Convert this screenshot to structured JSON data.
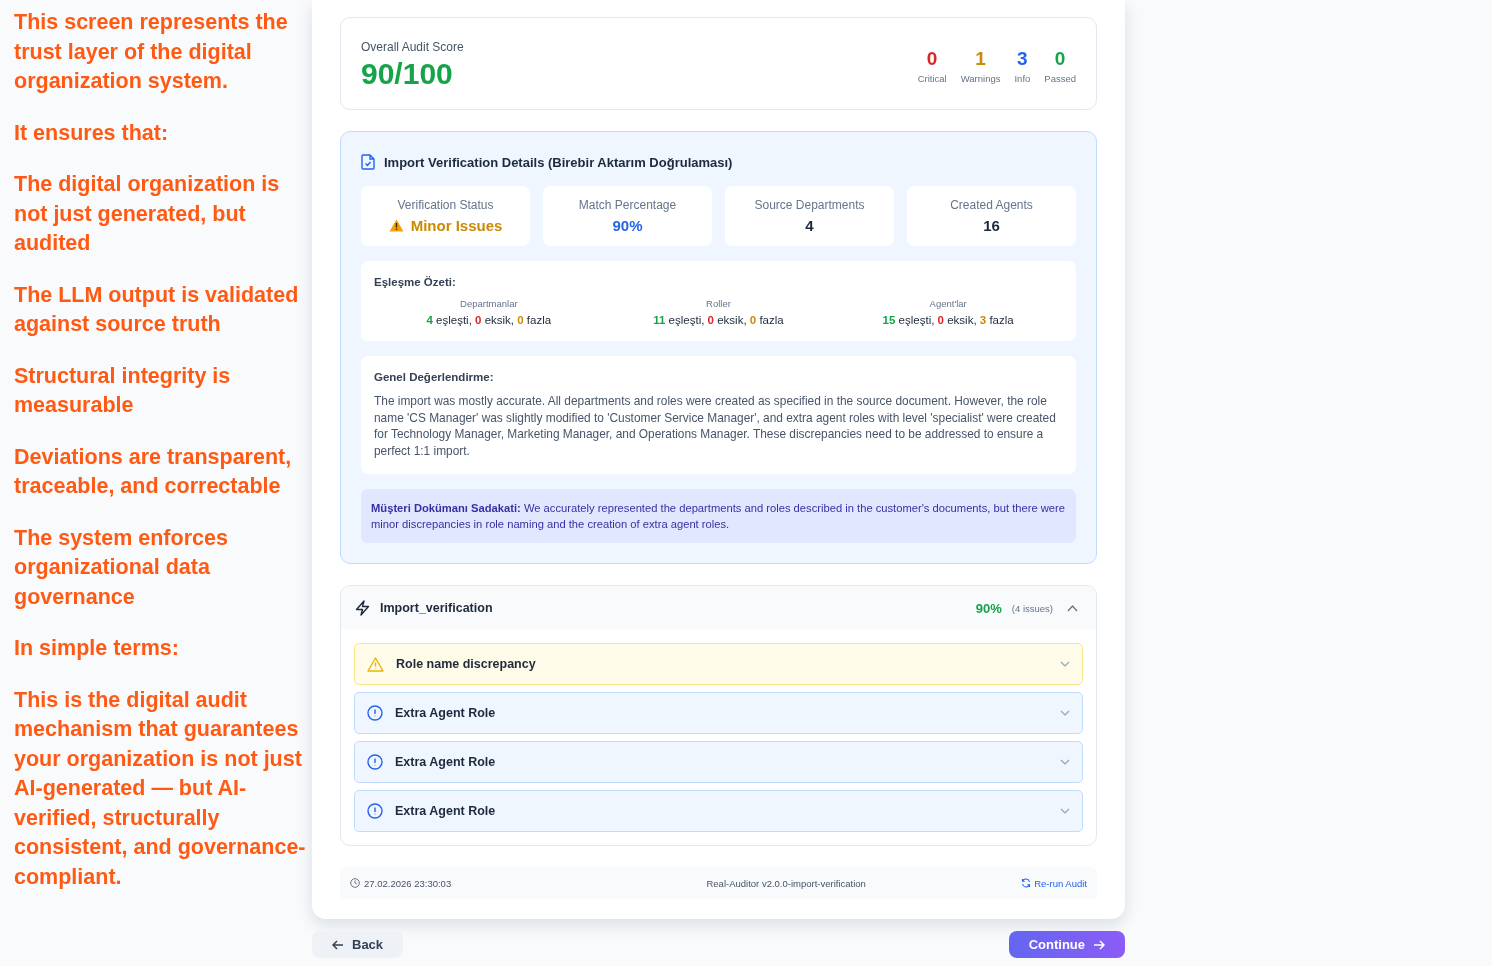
{
  "notes": [
    "This screen represents the trust layer of the digital organization system.",
    "It ensures that:",
    "The digital organization is not just generated, but audited",
    "The LLM output is validated against source truth",
    "Structural integrity is measurable",
    "Deviations are transparent, traceable, and correctable",
    "The system enforces organizational data governance",
    "In simple terms:",
    "This is the digital audit mechanism that guarantees your organization is not just AI-generated — but AI-verified, structurally consistent, and governance-compliant."
  ],
  "score": {
    "label": "Overall Audit Score",
    "value": "90/100",
    "counts": [
      {
        "value": "0",
        "label": "Critical",
        "color": "#dc2626"
      },
      {
        "value": "1",
        "label": "Warnings",
        "color": "#ca8a04"
      },
      {
        "value": "3",
        "label": "Info",
        "color": "#2563eb"
      },
      {
        "value": "0",
        "label": "Passed",
        "color": "#16a34a"
      }
    ]
  },
  "details": {
    "title": "Import Verification Details (Birebir Aktarım Doğrulaması)",
    "metrics": [
      {
        "label": "Verification Status",
        "value": "Minor Issues",
        "kind": "status"
      },
      {
        "label": "Match Percentage",
        "value": "90%",
        "kind": "percent"
      },
      {
        "label": "Source Departments",
        "value": "4",
        "kind": "count"
      },
      {
        "label": "Created Agents",
        "value": "16",
        "kind": "count"
      }
    ],
    "summary": {
      "title": "Eşleşme Özeti:",
      "groups": [
        {
          "label": "Departmanlar",
          "parts": [
            {
              "kind": "matched",
              "value": "4",
              "word": "eşleşti,"
            },
            {
              "kind": "missing",
              "value": "0",
              "word": "eksik,"
            },
            {
              "kind": "extra",
              "value": "0",
              "word": "fazla"
            }
          ]
        },
        {
          "label": "Roller",
          "parts": [
            {
              "kind": "matched",
              "value": "11",
              "word": "eşleşti,"
            },
            {
              "kind": "missing",
              "value": "0",
              "word": "eksik,"
            },
            {
              "kind": "extra",
              "value": "0",
              "word": "fazla"
            }
          ]
        },
        {
          "label": "Agent'lar",
          "parts": [
            {
              "kind": "matched",
              "value": "15",
              "word": "eşleşti,"
            },
            {
              "kind": "missing",
              "value": "0",
              "word": "eksik,"
            },
            {
              "kind": "extra",
              "value": "3",
              "word": "fazla"
            }
          ]
        }
      ]
    },
    "assessment": {
      "title": "Genel Değerlendirme:",
      "text": "The import was mostly accurate. All departments and roles were created as specified in the source document. However, the role name 'CS Manager' was slightly modified to 'Customer Service Manager', and extra agent roles with level 'specialist' were created for Technology Manager, Marketing Manager, and Operations Manager. These discrepancies need to be addressed to ensure a perfect 1:1 import."
    },
    "fidelity": "**Müşteri Dokümanı Sadakati:** We accurately represented the departments and roles described in the customer's documents, but there were minor discrepancies in role naming and the creation of extra agent roles."
  },
  "section": {
    "title": "Import_verification",
    "score": "90%",
    "issues_count": "(4 issues)",
    "expanded": true,
    "issues": [
      {
        "kind": "warning",
        "title": "Role name discrepancy",
        "expanded": false
      },
      {
        "kind": "info",
        "title": "Extra Agent Role",
        "expanded": false
      },
      {
        "kind": "info",
        "title": "Extra Agent Role",
        "expanded": false
      },
      {
        "kind": "info",
        "title": "Extra Agent Role",
        "expanded": false
      }
    ]
  },
  "footer": {
    "timestamp": "27.02.2026 23:30:03",
    "version": "Real-Auditor v2.0.0-import-verification",
    "rerun": "Re-run Audit"
  },
  "buttons": {
    "back": "Back",
    "continue": "Continue"
  }
}
